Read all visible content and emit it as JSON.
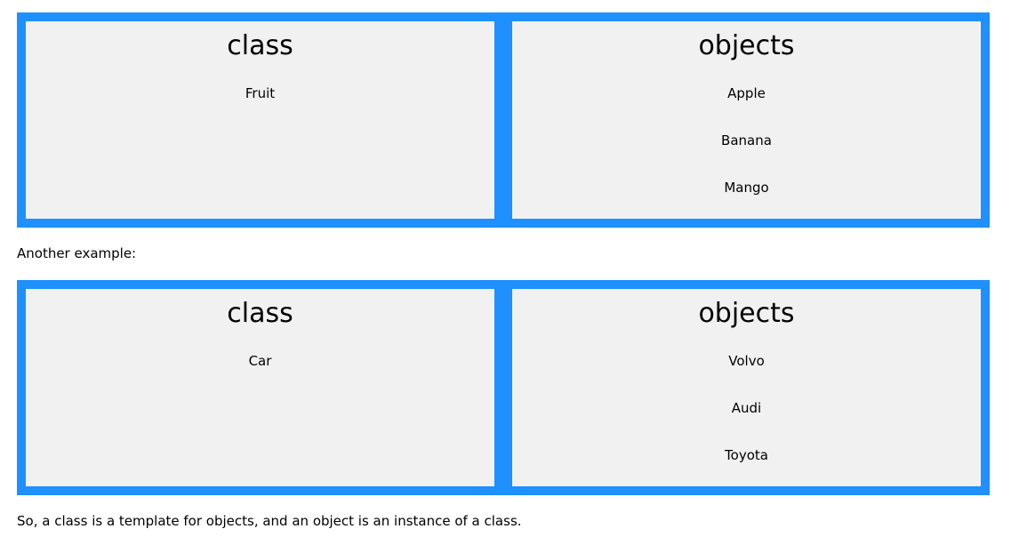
{
  "examples": [
    {
      "class_title": "class",
      "class_items": [
        "Fruit"
      ],
      "objects_title": "objects",
      "object_items": [
        "Apple",
        "Banana",
        "Mango"
      ]
    },
    {
      "class_title": "class",
      "class_items": [
        "Car"
      ],
      "objects_title": "objects",
      "object_items": [
        "Volvo",
        "Audi",
        "Toyota"
      ]
    }
  ],
  "text": {
    "another_example": "Another example:",
    "summary": "So, a class is a template for objects, and an object is an instance of a class."
  },
  "colors": {
    "container_bg": "#1e90ff",
    "panel_bg": "#f1f1f1",
    "text": "#000000"
  }
}
